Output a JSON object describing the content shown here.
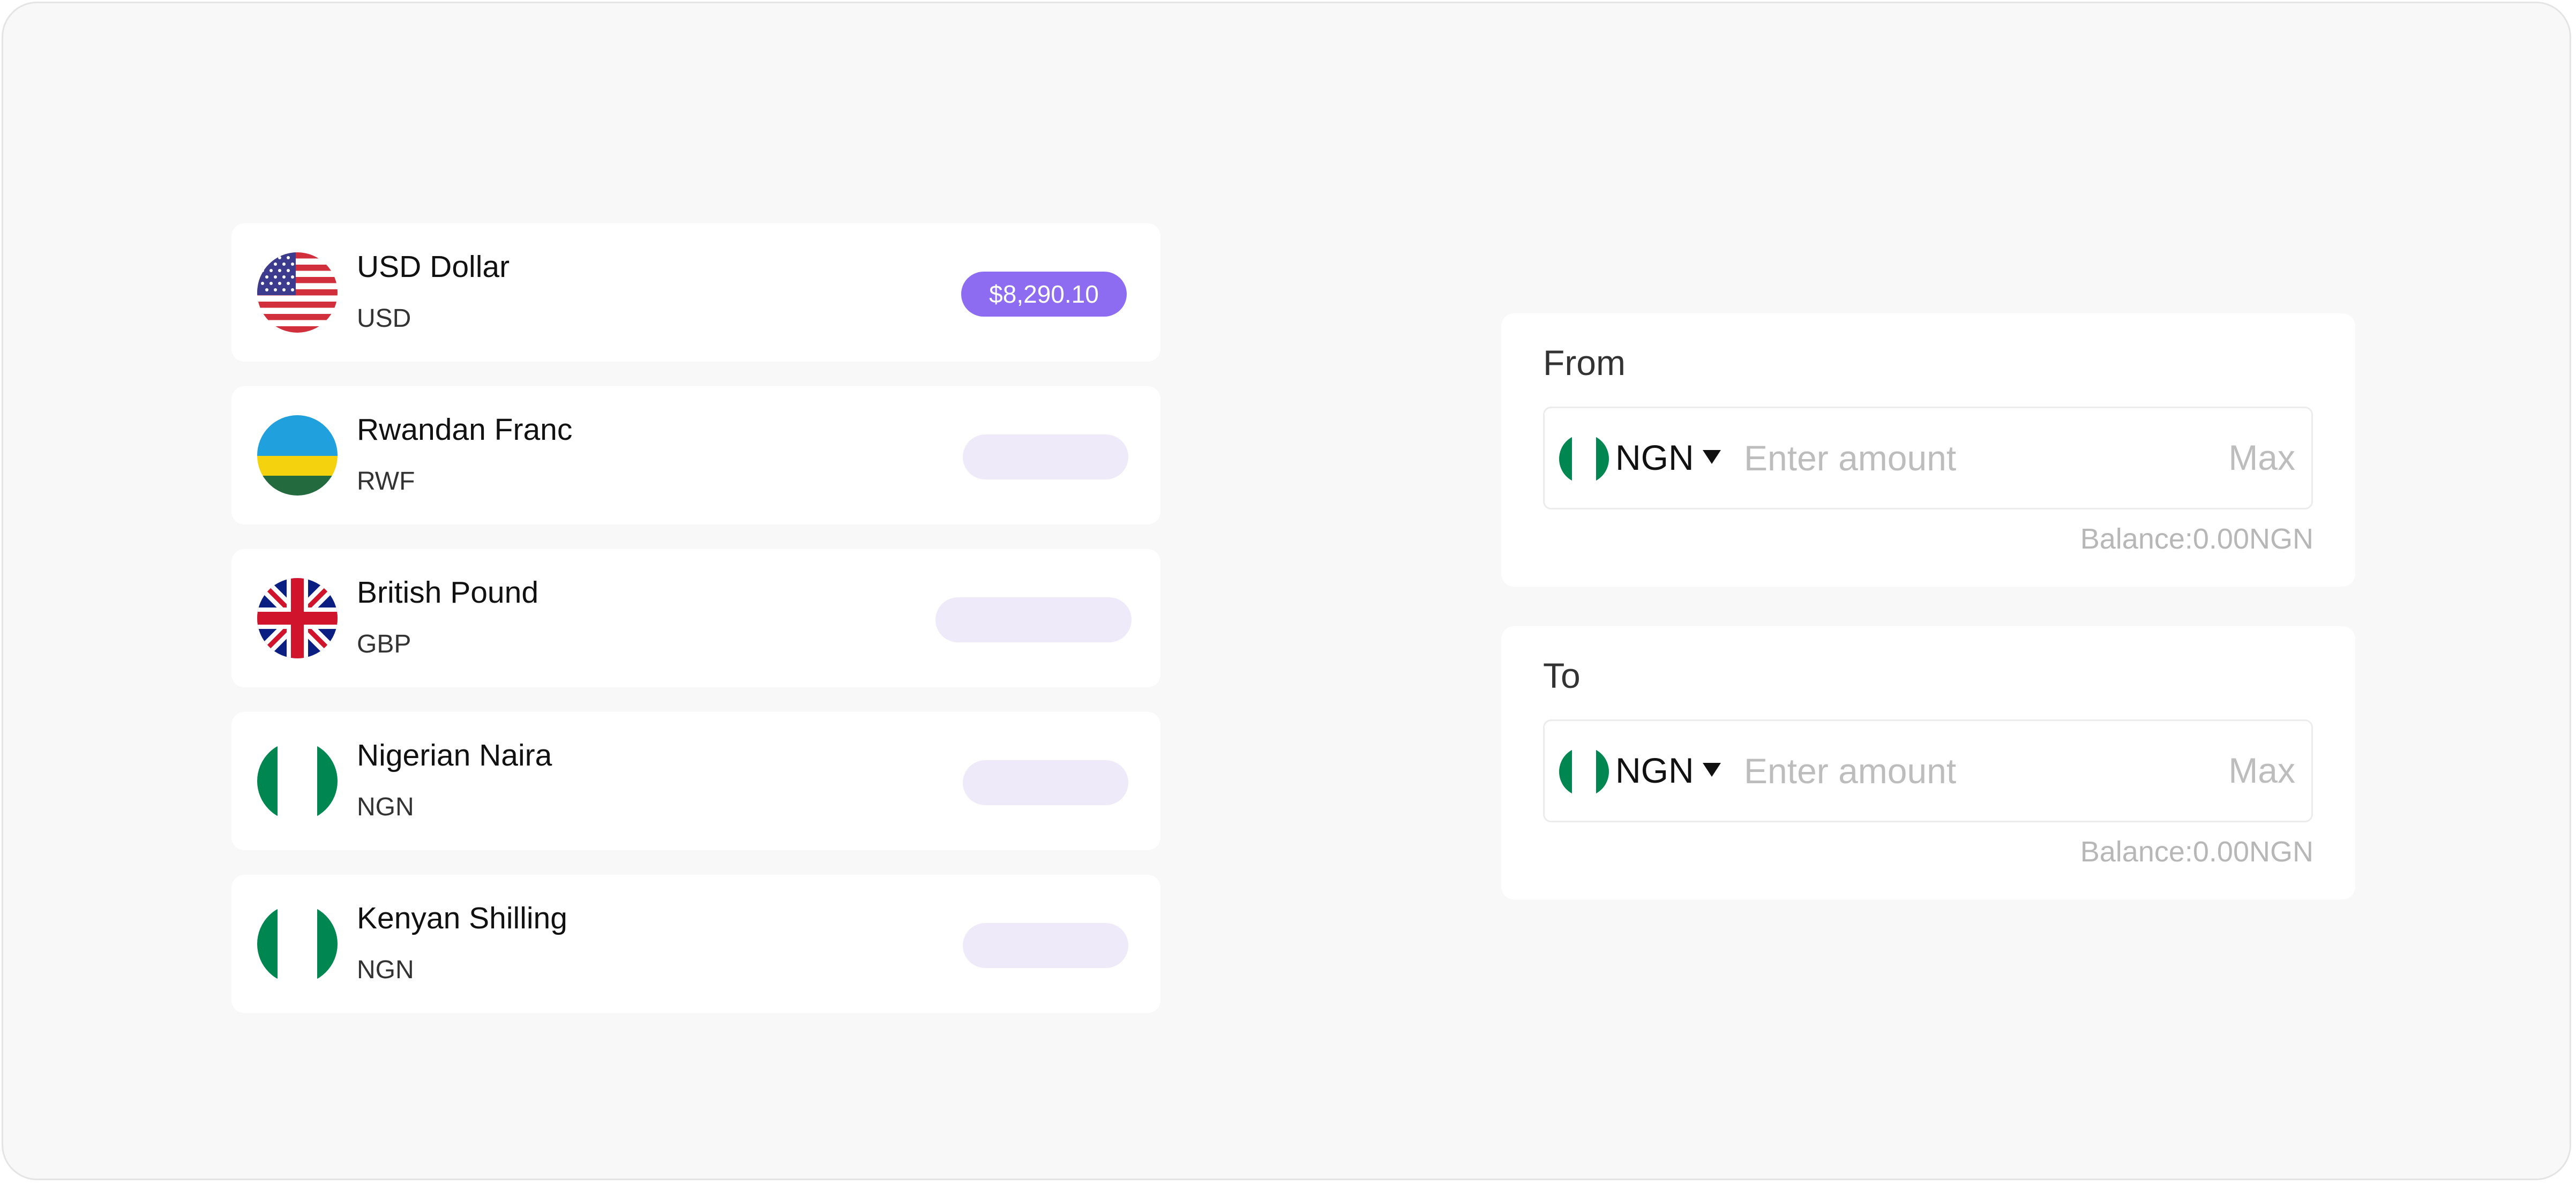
{
  "currencies": [
    {
      "name": "USD Dollar",
      "code": "USD",
      "flag_icon": "us-flag-icon",
      "balance": "$8,290.10",
      "loading": false
    },
    {
      "name": "Rwandan Franc",
      "code": "RWF",
      "flag_icon": "rwanda-flag-icon",
      "balance": "",
      "loading": true
    },
    {
      "name": "British Pound",
      "code": "GBP",
      "flag_icon": "uk-flag-icon",
      "balance": "",
      "loading": true
    },
    {
      "name": "Nigerian Naira",
      "code": "NGN",
      "flag_icon": "nigeria-flag-icon",
      "balance": "",
      "loading": true
    },
    {
      "name": "Kenyan Shilling",
      "code": "NGN",
      "flag_icon": "nigeria-flag-icon",
      "balance": "",
      "loading": true
    }
  ],
  "converter": {
    "from": {
      "label": "From",
      "currency": "NGN",
      "flag_icon": "nigeria-flag-icon",
      "placeholder": "Enter amount",
      "value": "",
      "max_label": "Max",
      "balance": "Balance:0.00NGN"
    },
    "to": {
      "label": "To",
      "currency": "NGN",
      "flag_icon": "nigeria-flag-icon",
      "placeholder": "Enter amount",
      "value": "",
      "max_label": "Max",
      "balance": "Balance:0.00NGN"
    }
  },
  "colors": {
    "accent": "#8d6cf2",
    "skeleton": "#efeafa",
    "background": "#f8f8f8",
    "card": "#ffffff",
    "nigeria_green": "#008751"
  }
}
